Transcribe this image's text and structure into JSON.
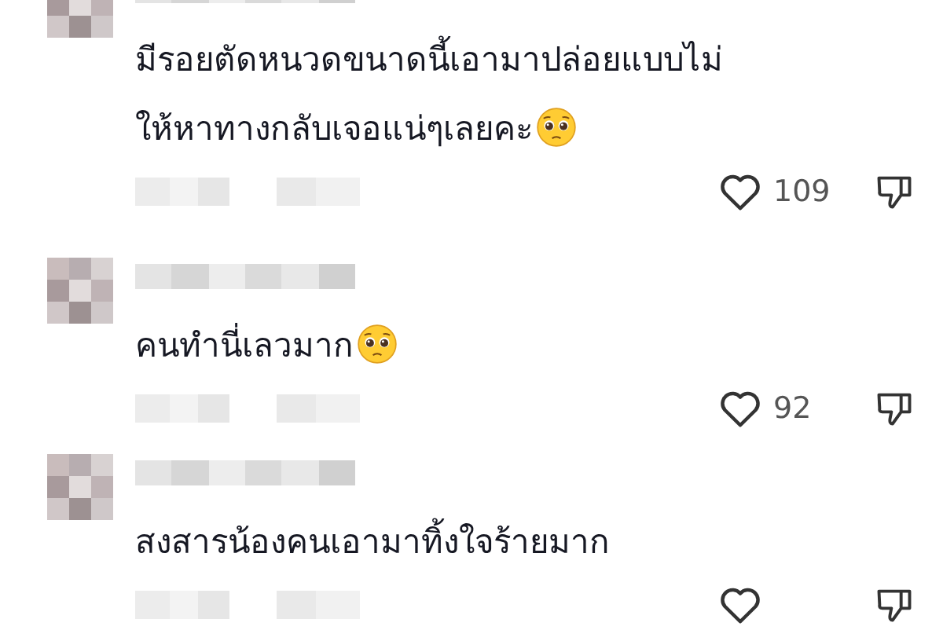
{
  "comments": [
    {
      "text_lines": [
        "มีรอยตัดหนวดขนาดนี้เอามาปล่อยแบบไม่",
        "ให้หาทางกลับเจอแน่ๆเลยคะ"
      ],
      "emoji": true,
      "likes": "109"
    },
    {
      "text_lines": [
        "คนทำนี่เลวมาก"
      ],
      "emoji": true,
      "likes": "92"
    },
    {
      "text_lines": [
        "สงสารน้องคนเอามาทิ้งใจร้ายมาก"
      ],
      "emoji": false
    }
  ]
}
